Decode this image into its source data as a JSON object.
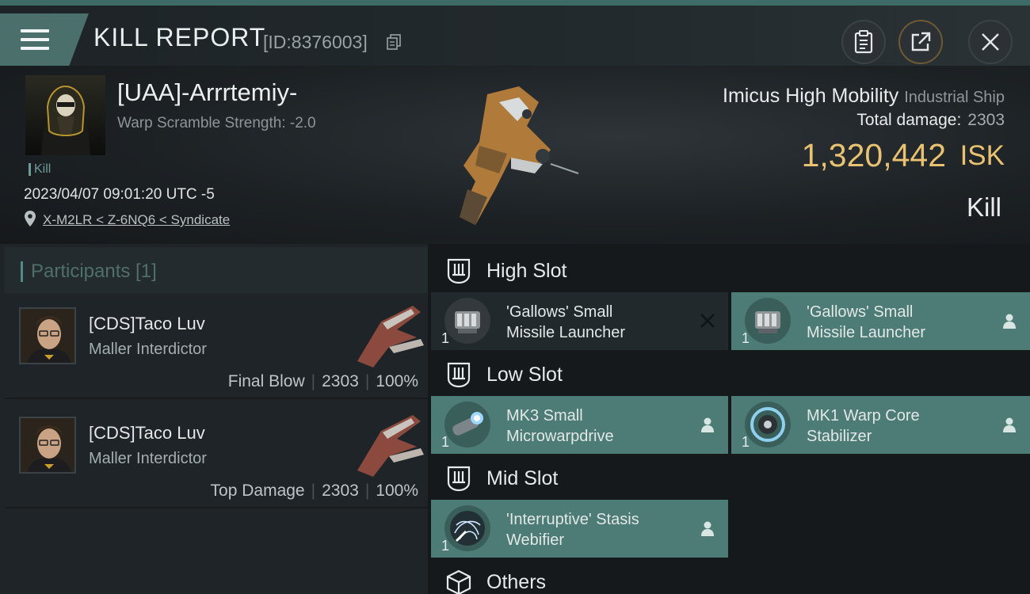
{
  "header": {
    "title": "KILL REPORT",
    "report_id": "[ID:8376003]"
  },
  "victim": {
    "name": "[UAA]-Arrrtemiy-",
    "warp_scramble": "Warp Scramble Strength: -2.0",
    "kill_tag": "Kill",
    "timestamp": "2023/04/07 09:01:20 UTC -5",
    "location": "X-M2LR < Z-6NQ6 < Syndicate"
  },
  "ship": {
    "name": "Imicus High Mobility",
    "class": "Industrial Ship",
    "total_damage_label": "Total damage:",
    "total_damage_value": "2303",
    "isk_value": "1,320,442",
    "isk_label": "ISK",
    "result": "Kill"
  },
  "participants": {
    "title": "Participants [1]",
    "items": [
      {
        "name": "[CDS]Taco Luv",
        "ship": "Maller Interdictor",
        "role": "Final Blow",
        "damage": "2303",
        "percent": "100%"
      },
      {
        "name": "[CDS]Taco Luv",
        "ship": "Maller Interdictor",
        "role": "Top Damage",
        "damage": "2303",
        "percent": "100%"
      }
    ]
  },
  "slots": {
    "high": {
      "title": "High Slot",
      "modules": [
        {
          "name": "'Gallows' Small\nMissile Launcher",
          "qty": "1",
          "state": "destroyed"
        },
        {
          "name": "'Gallows' Small\nMissile Launcher",
          "qty": "1",
          "state": "dropped"
        }
      ]
    },
    "low": {
      "title": "Low Slot",
      "modules": [
        {
          "name": "MK3 Small\nMicrowarpdrive",
          "qty": "1",
          "state": "dropped"
        },
        {
          "name": "MK1 Warp Core\nStabilizer",
          "qty": "1",
          "state": "dropped"
        }
      ]
    },
    "mid": {
      "title": "Mid Slot",
      "modules": [
        {
          "name": "'Interruptive' Stasis\nWebifier",
          "qty": "1",
          "state": "dropped"
        }
      ]
    },
    "others": {
      "title": "Others"
    }
  },
  "colors": {
    "accent_teal": "#4c7c75",
    "isk_gold": "#e8c271"
  }
}
